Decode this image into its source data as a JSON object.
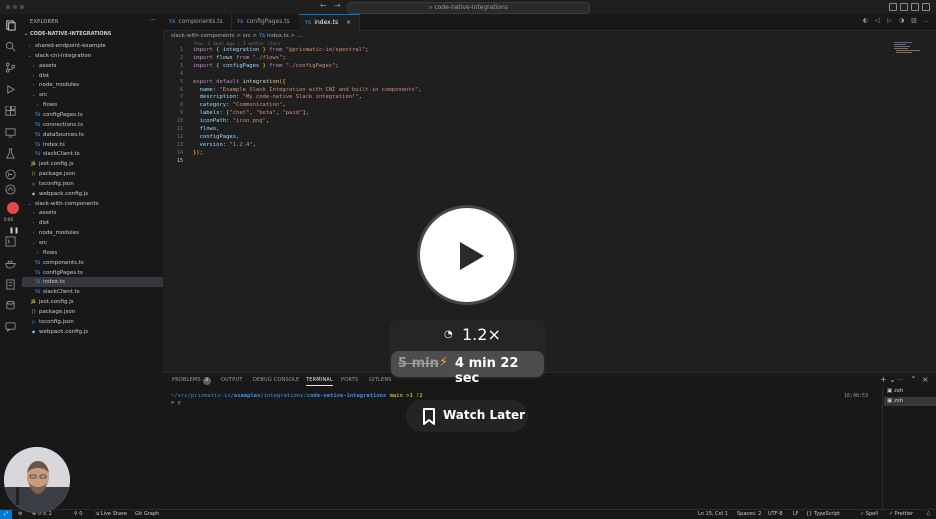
{
  "titlebar": {
    "command_center": "code-native-integrations",
    "back": "←",
    "forward": "→"
  },
  "sidebar": {
    "title": "EXPLORER",
    "more": "···",
    "root": "CODE-NATIVE-INTEGRATIONS",
    "items": [
      {
        "label": "shared-endpoint-example",
        "icon": "›",
        "kind": "folder",
        "indent": 1
      },
      {
        "label": "slack-cni-integration",
        "icon": "⌄",
        "kind": "folder",
        "indent": 1
      },
      {
        "label": "assets",
        "icon": "›",
        "kind": "folder",
        "indent": 2
      },
      {
        "label": "dist",
        "icon": "›",
        "kind": "folder",
        "indent": 2
      },
      {
        "label": "node_modules",
        "icon": "›",
        "kind": "folder",
        "indent": 2
      },
      {
        "label": "src",
        "icon": "⌄",
        "kind": "folder",
        "indent": 2
      },
      {
        "label": "flows",
        "icon": "›",
        "kind": "folder",
        "indent": 3
      },
      {
        "label": "configPages.ts",
        "icon": "TS",
        "kind": "ts",
        "indent": 3
      },
      {
        "label": "connections.ts",
        "icon": "TS",
        "kind": "ts",
        "indent": 3
      },
      {
        "label": "dataSources.ts",
        "icon": "TS",
        "kind": "ts",
        "indent": 3
      },
      {
        "label": "index.ts",
        "icon": "TS",
        "kind": "ts",
        "indent": 3
      },
      {
        "label": "slackClient.ts",
        "icon": "TS",
        "kind": "ts",
        "indent": 3
      },
      {
        "label": "jest.config.js",
        "icon": "JS",
        "kind": "js",
        "indent": 2
      },
      {
        "label": "package.json",
        "icon": "{}",
        "kind": "json",
        "indent": 2
      },
      {
        "label": "tsconfig.json",
        "icon": "▤",
        "kind": "tsconfig",
        "indent": 2
      },
      {
        "label": "webpack.config.js",
        "icon": "◆",
        "kind": "wp",
        "indent": 2
      },
      {
        "label": "slack-with-components",
        "icon": "⌄",
        "kind": "folder",
        "indent": 1
      },
      {
        "label": "assets",
        "icon": "›",
        "kind": "folder",
        "indent": 2
      },
      {
        "label": "dist",
        "icon": "›",
        "kind": "folder",
        "indent": 2
      },
      {
        "label": "node_modules",
        "icon": "›",
        "kind": "folder",
        "indent": 2
      },
      {
        "label": "src",
        "icon": "⌄",
        "kind": "folder",
        "indent": 2
      },
      {
        "label": "flows",
        "icon": "›",
        "kind": "folder",
        "indent": 3
      },
      {
        "label": "components.ts",
        "icon": "TS",
        "kind": "ts",
        "indent": 3
      },
      {
        "label": "configPages.ts",
        "icon": "TS",
        "kind": "ts",
        "indent": 3
      },
      {
        "label": "index.ts",
        "icon": "TS",
        "kind": "ts",
        "indent": 3,
        "selected": true
      },
      {
        "label": "slackClient.ts",
        "icon": "TS",
        "kind": "ts",
        "indent": 3
      },
      {
        "label": "jest.config.js",
        "icon": "JS",
        "kind": "js",
        "indent": 2
      },
      {
        "label": "package.json",
        "icon": "{}",
        "kind": "json",
        "indent": 2
      },
      {
        "label": "tsconfig.json",
        "icon": "▤",
        "kind": "tsconfig",
        "indent": 2
      },
      {
        "label": "webpack.config.js",
        "icon": "◆",
        "kind": "wp",
        "indent": 2
      }
    ]
  },
  "recorder": {
    "label": "0:00"
  },
  "tabs": [
    {
      "icon": "TS",
      "label": "components.ts"
    },
    {
      "icon": "TS",
      "label": "configPages.ts"
    },
    {
      "icon": "TS",
      "label": "index.ts",
      "active": true,
      "close": "×"
    }
  ],
  "breadcrumbs": {
    "folder": "slack-with-components",
    "sep": ">",
    "src": "src",
    "icon": "TS",
    "file": "index.ts",
    "ellipsis": "…"
  },
  "editor": {
    "blame": "You, 3 days ago | 1 author (You)",
    "line_numbers": [
      "1",
      "2",
      "3",
      "4",
      "5",
      "6",
      "7",
      "8",
      "9",
      "10",
      "11",
      "12",
      "13",
      "14",
      "15"
    ],
    "current_line": "15",
    "lines": [
      [
        {
          "t": "import",
          "c": "kw"
        },
        {
          "t": " { ",
          "c": "br"
        },
        {
          "t": "integration",
          "c": "id"
        },
        {
          "t": " } ",
          "c": "br"
        },
        {
          "t": "from ",
          "c": "kw"
        },
        {
          "t": "\"@prismatic-io/spectral\"",
          "c": "str"
        },
        {
          "t": ";",
          "c": ""
        }
      ],
      [
        {
          "t": "import",
          "c": "kw"
        },
        {
          "t": " flows ",
          "c": "id"
        },
        {
          "t": "from ",
          "c": "kw"
        },
        {
          "t": "\"./flows\"",
          "c": "str"
        },
        {
          "t": ";",
          "c": ""
        }
      ],
      [
        {
          "t": "import",
          "c": "kw"
        },
        {
          "t": " { ",
          "c": "br"
        },
        {
          "t": "configPages",
          "c": "id"
        },
        {
          "t": " } ",
          "c": "br"
        },
        {
          "t": "from ",
          "c": "kw"
        },
        {
          "t": "\"./configPages\"",
          "c": "str"
        },
        {
          "t": ";",
          "c": ""
        }
      ],
      [],
      [
        {
          "t": "export default ",
          "c": "kw"
        },
        {
          "t": "integration",
          "c": "fn"
        },
        {
          "t": "({",
          "c": "br"
        }
      ],
      [
        {
          "t": "  name",
          "c": "id"
        },
        {
          "t": ": ",
          "c": ""
        },
        {
          "t": "\"Example Slack Integration with CNI and built-in components\"",
          "c": "str"
        },
        {
          "t": ",",
          "c": ""
        }
      ],
      [
        {
          "t": "  description",
          "c": "id"
        },
        {
          "t": ": ",
          "c": ""
        },
        {
          "t": "\"My code-native Slack integration!\"",
          "c": "str"
        },
        {
          "t": ",",
          "c": ""
        }
      ],
      [
        {
          "t": "  category",
          "c": "id"
        },
        {
          "t": ": ",
          "c": ""
        },
        {
          "t": "\"Communication\"",
          "c": "str"
        },
        {
          "t": ",",
          "c": ""
        }
      ],
      [
        {
          "t": "  labels",
          "c": "id"
        },
        {
          "t": ": [",
          "c": ""
        },
        {
          "t": "\"chat\"",
          "c": "str"
        },
        {
          "t": ", ",
          "c": ""
        },
        {
          "t": "\"beta\"",
          "c": "str"
        },
        {
          "t": ", ",
          "c": ""
        },
        {
          "t": "\"paid\"",
          "c": "str"
        },
        {
          "t": "],",
          "c": ""
        }
      ],
      [
        {
          "t": "  iconPath",
          "c": "id"
        },
        {
          "t": ": ",
          "c": ""
        },
        {
          "t": "\"icon.png\"",
          "c": "str"
        },
        {
          "t": ",",
          "c": ""
        }
      ],
      [
        {
          "t": "  flows",
          "c": "id"
        },
        {
          "t": ",",
          "c": ""
        }
      ],
      [
        {
          "t": "  configPages",
          "c": "id"
        },
        {
          "t": ",",
          "c": ""
        }
      ],
      [
        {
          "t": "  version",
          "c": "id"
        },
        {
          "t": ": ",
          "c": ""
        },
        {
          "t": "\"1.2.4\"",
          "c": "str"
        },
        {
          "t": ",",
          "c": ""
        }
      ],
      [
        {
          "t": "});",
          "c": "br"
        }
      ],
      []
    ]
  },
  "panel": {
    "tabs": [
      "PROBLEMS",
      "OUTPUT",
      "DEBUG CONSOLE",
      "TERMINAL",
      "PORTS",
      "GITLENS"
    ],
    "active_tab": "TERMINAL",
    "problems_count": "2",
    "terminal": {
      "path_prefix": "~/src/prismatic-io/",
      "path_dir1": "examples",
      "path_mid": "/integrations/",
      "path_dir2": "code-native-integrations",
      "branch": " main ",
      "status": ">1 !2",
      "prompt": "> ▯",
      "time": "16:46:53"
    },
    "shells": [
      "zsh",
      "zsh"
    ],
    "controls": {
      "add": "+",
      "chev": "⌄",
      "more": "···",
      "max": "⌃",
      "close": "×"
    }
  },
  "status": {
    "errors": "⊗ 0 ⚠ 2",
    "ports": "⚲ 0",
    "live_share": "Live Share",
    "git_graph": "Git Graph",
    "position": "Ln 15, Col 1",
    "spaces": "Spaces: 2",
    "encoding": "UTF-8",
    "eol": "LF",
    "language": "TypeScript",
    "spell": "Spell",
    "prettier": "✓ Prettier"
  },
  "player": {
    "speed": "1.2×",
    "original_duration": "5 min",
    "new_duration": "4 min 22 sec",
    "watch_later": "Watch Later"
  },
  "colors": {
    "accent": "#0078d4",
    "record": "#e5484d",
    "bolt": "#f5a623"
  }
}
